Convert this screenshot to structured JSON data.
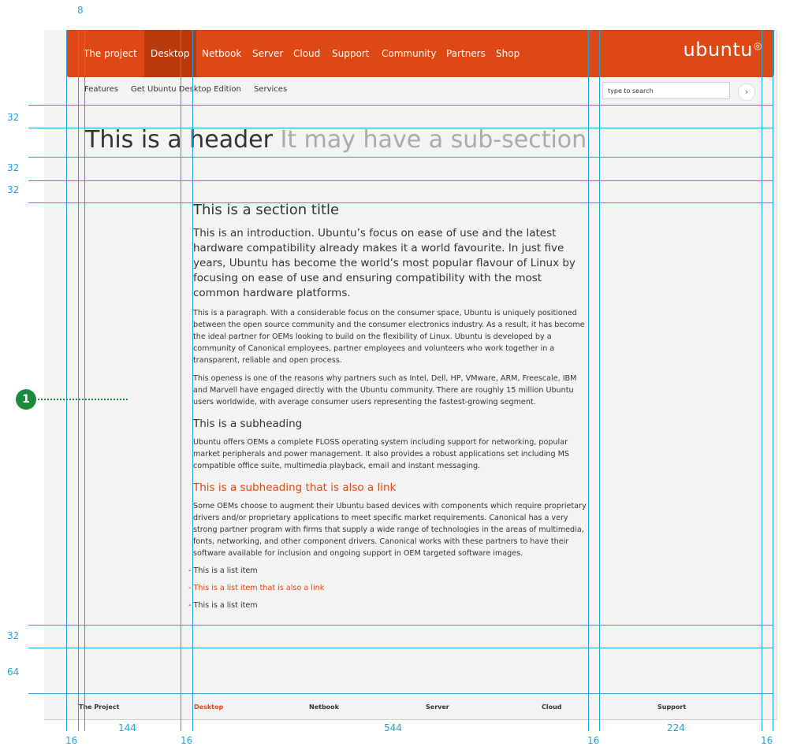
{
  "topnav": {
    "items": [
      "The project",
      "Desktop",
      "Netbook",
      "Server",
      "Cloud",
      "Support",
      "Community",
      "Partners",
      "Shop"
    ],
    "logo": "ubuntu"
  },
  "subnav": {
    "items": [
      "Features",
      "Get Ubuntu Desktop Edition",
      "Services"
    ]
  },
  "search": {
    "placeholder": "type to search",
    "button": "›"
  },
  "header": {
    "title": "This is a header",
    "subtitle": "It may have a sub-section"
  },
  "content": {
    "section_title": "This is a section title",
    "intro": "This is an introduction. Ubuntu’s focus on ease of use and the latest hardware compatibility already makes it a world favourite. In just five years, Ubuntu has become the world’s most popular flavour of Linux by focusing on ease of use and ensuring compatibility with the most common hardware platforms.",
    "p1": "This is a paragraph. With a considerable focus on the consumer space, Ubuntu is uniquely positioned between the open source community and the consumer electronics industry. As a result, it has become the ideal partner for OEMs looking to build on the flexibility of Linux. Ubuntu is developed by a community of Canonical employees, partner employees and volunteers who work together in a transparent, reliable and open process.",
    "p2": "This openess is one of the reasons why partners such as Intel, Dell, HP, VMware, ARM, Freescale, IBM and Marvell have engaged directly with the Ubuntu community. There are roughly 15 million Ubuntu users worldwide, with average consumer users representing the fastest-growing segment.",
    "subheading": "This is a subheading",
    "p3": "Ubuntu offers OEMs a complete FLOSS operating system including support for networking, popular market peripherals and power management. It also provides a robust applications set including MS compatible office suite, multimedia playback, email and instant messaging.",
    "subheading_link": "This is a subheading that is also a link",
    "p4": "Some OEMs choose to augment their Ubuntu based devices with components which require proprietary drivers and/or proprietary applications to meet specific market requirements. Canonical has a very strong partner program with firms that supply a wide range of technologies in the areas of multimedia, fonts, networking, and other component drivers. Canonical works with these partners to have their software available for inclusion and ongoing support in OEM targeted software images.",
    "list": [
      "- This is a list item",
      "- This is a list item that is also a link",
      "- This is a list item"
    ]
  },
  "footer": {
    "items": [
      "The Project",
      "Desktop",
      "Netbook",
      "Server",
      "Cloud",
      "Support"
    ]
  },
  "measurements": {
    "top": "8",
    "left": [
      "32",
      "32",
      "32",
      "32",
      "64"
    ],
    "bottom": [
      "16",
      "144",
      "16",
      "544",
      "16",
      "224",
      "16"
    ]
  },
  "annotation": {
    "marker": "1"
  },
  "colors": {
    "brand": "#dd4814",
    "guide": "#2aa0d8",
    "marker": "#1e8a3c"
  }
}
